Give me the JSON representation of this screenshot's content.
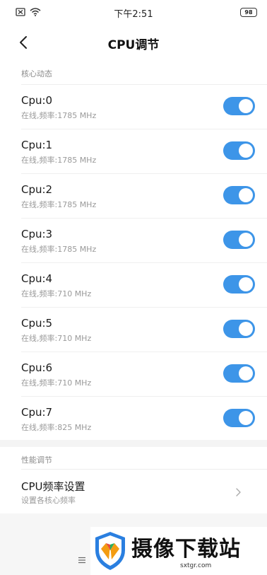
{
  "status_bar": {
    "time": "下午2:51",
    "battery": "98",
    "icons": [
      "sim-off-icon",
      "wifi-icon",
      "battery-icon"
    ]
  },
  "nav": {
    "title": "CPU调节",
    "back_icon": "back-arrow-icon"
  },
  "sections": {
    "core_dynamic": "核心动态",
    "performance": "性能调节"
  },
  "cpus": [
    {
      "name": "Cpu:0",
      "status": "在线,频率:1785 MHz",
      "enabled": true
    },
    {
      "name": "Cpu:1",
      "status": "在线,频率:1785 MHz",
      "enabled": true
    },
    {
      "name": "Cpu:2",
      "status": "在线,频率:1785 MHz",
      "enabled": true
    },
    {
      "name": "Cpu:3",
      "status": "在线,频率:1785 MHz",
      "enabled": true
    },
    {
      "name": "Cpu:4",
      "status": "在线,频率:710 MHz",
      "enabled": true
    },
    {
      "name": "Cpu:5",
      "status": "在线,频率:710 MHz",
      "enabled": true
    },
    {
      "name": "Cpu:6",
      "status": "在线,频率:710 MHz",
      "enabled": true
    },
    {
      "name": "Cpu:7",
      "status": "在线,频率:825 MHz",
      "enabled": true
    }
  ],
  "perf": {
    "title": "CPU频率设置",
    "subtitle": "设置各核心频率",
    "icon": "chevron-right-icon"
  },
  "watermark": {
    "text": "摄像下载站",
    "url": "sxtgr.com"
  },
  "colors": {
    "accent": "#3d95e8",
    "background": "#f6f6f6"
  }
}
